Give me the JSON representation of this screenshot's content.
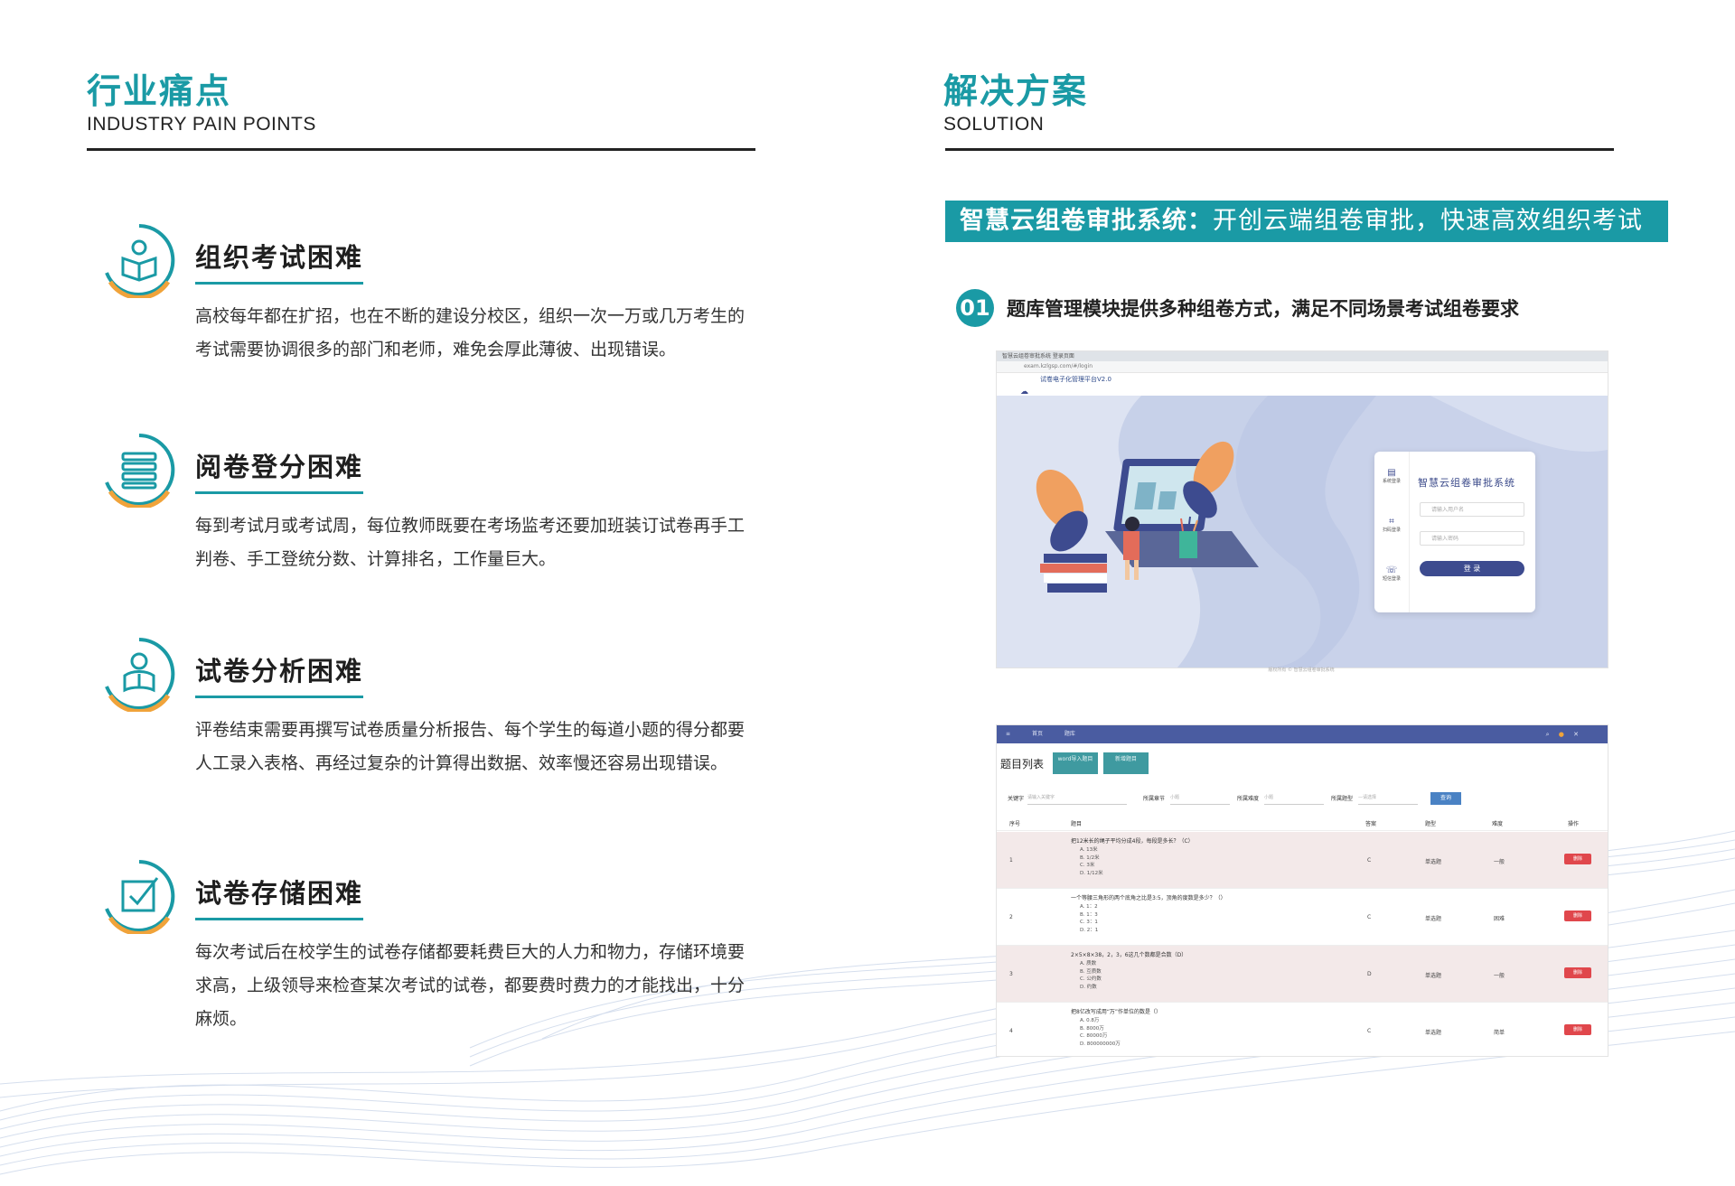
{
  "left": {
    "title": "行业痛点",
    "subtitle": "INDUSTRY PAIN POINTS",
    "items": [
      {
        "icon": "reading-icon",
        "heading": "组织考试困难",
        "text": "高校每年都在扩招，也在不断的建设分校区，组织一次一万或几万考生的考试需要协调很多的部门和老师，难免会厚此薄彼、出现错误。"
      },
      {
        "icon": "stack-icon",
        "heading": "阅卷登分困难",
        "text": "每到考试月或考试周，每位教师既要在考场监考还要加班装订试卷再手工判卷、手工登统分数、计算排名，工作量巨大。"
      },
      {
        "icon": "student-book-icon",
        "heading": "试卷分析困难",
        "text": "评卷结束需要再撰写试卷质量分析报告、每个学生的每道小题的得分都要人工录入表格、再经过复杂的计算得出数据、效率慢还容易出现错误。"
      },
      {
        "icon": "checkbox-icon",
        "heading": "试卷存储困难",
        "text": "每次考试后在校学生的试卷存储都要耗费巨大的人力和物力，存储环境要求高，上级领导来检查某次考试的试卷，都要费时费力的才能找出，十分麻烦。"
      }
    ]
  },
  "right": {
    "title": "解决方案",
    "subtitle": "SOLUTION",
    "banner_bold": "智慧云组卷审批系统：",
    "banner_rest": "开创云端组卷审批，快速高效组织考试",
    "point_number": "01",
    "point_text": "题库管理模块提供多种组卷方式，满足不同场景考试组卷要求",
    "shot1": {
      "tab_text": "智慧云组卷审批系统    登录页面",
      "address": "exam.kzlgsp.com/#/login",
      "app_name": "试卷电子化管理平台V2.0",
      "login_title": "智慧云组卷审批系统",
      "username_placeholder": "请输入用户名",
      "password_placeholder": "请输入密码",
      "login_button": "登 录",
      "side_items": [
        "系统登录",
        "扫码登录",
        "短信登录"
      ],
      "footer": "版权所有 © 智慧云组卷审批系统"
    },
    "shot2": {
      "nav": [
        "首页",
        "题库"
      ],
      "list_title": "题目列表",
      "btn1": "word导入题目",
      "btn2": "新增题目",
      "filter_keyword_label": "关键字",
      "filter_keyword_placeholder": "请输入关键字",
      "filter_point_label": "所属章节",
      "filter_point_value": "小题",
      "filter_diff_label": "所属难度",
      "filter_diff_value": "小题",
      "filter_type_label": "所属题型",
      "filter_type_value": "—请选择",
      "query_button": "查询",
      "columns": [
        "序号",
        "题目",
        "答案",
        "题型",
        "难度",
        "操作"
      ],
      "rows": [
        {
          "no": "1",
          "question": "把12米长的绳子平均分成4段，每段是多长？（C）",
          "options": [
            "A. 13米",
            "B. 1/2米",
            "C. 3米",
            "D. 1/12米"
          ],
          "answer": "C",
          "type": "单选题",
          "difficulty": "一般",
          "action": "删除"
        },
        {
          "no": "2",
          "question": "一个等腰三角形的两个底角之比是3:5，顶角的度数是多少？（）",
          "options": [
            "A. 1：2",
            "B. 1：3",
            "C. 3：1",
            "D. 2：1"
          ],
          "answer": "C",
          "type": "单选题",
          "difficulty": "困难",
          "action": "删除"
        },
        {
          "no": "3",
          "question": "2×5×8×38，2，3，6这几个数都是合数（D）",
          "options": [
            "A. 质数",
            "B. 互质数",
            "C. 公约数",
            "D. 约数"
          ],
          "answer": "D",
          "type": "单选题",
          "difficulty": "一般",
          "action": "删除"
        },
        {
          "no": "4",
          "question": "把8亿改写成用“万”作单位的数是（）",
          "options": [
            "A. 0.8万",
            "B. 8000万",
            "C. 80000万",
            "D. 800000000万"
          ],
          "answer": "C",
          "type": "单选题",
          "difficulty": "简单",
          "action": "删除"
        }
      ]
    }
  },
  "colors": {
    "accent": "#1a9aa5",
    "orange": "#f0a33a",
    "navy": "#3d4b8f",
    "delete": "#e0474c"
  }
}
